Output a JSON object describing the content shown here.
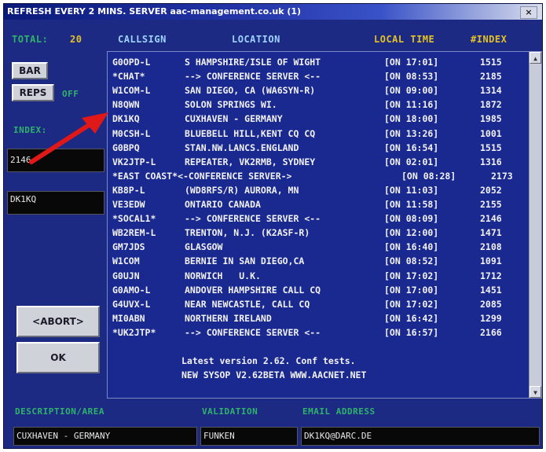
{
  "window": {
    "title": "REFRESH EVERY 2 MINS.  SERVER aac-management.co.uk (1)",
    "ctrl": "×"
  },
  "header": {
    "total_label": "TOTAL:",
    "total_value": "20",
    "callsign": "CALLSIGN",
    "location": "LOCATION",
    "local_time": "LOCAL TIME",
    "index": "#INDEX"
  },
  "sidebar": {
    "bar": "BAR",
    "reps": "REPS",
    "reps_state": "OFF",
    "index_label": "INDEX:",
    "index_value": "2146",
    "callsign_value": "DK1KQ",
    "abort": "<ABORT>",
    "ok": "OK"
  },
  "rows": [
    {
      "call": "G0OPD-L",
      "loc": "S HAMPSHIRE/ISLE OF WIGHT",
      "time": "[ON 17:01]",
      "idx": "1515"
    },
    {
      "call": "*CHAT*",
      "loc": "--> CONFERENCE SERVER <--",
      "time": "[ON 08:53]",
      "idx": "2185"
    },
    {
      "call": "W1COM-L",
      "loc": "SAN DIEGO, CA (WA6SYN-R)",
      "time": "[ON 09:00]",
      "idx": "1314"
    },
    {
      "call": "N8QWN",
      "loc": "SOLON SPRINGS WI.",
      "time": "[ON 11:16]",
      "idx": "1872"
    },
    {
      "call": "DK1KQ",
      "loc": "CUXHAVEN - GERMANY",
      "time": "[ON 18:00]",
      "idx": "1985"
    },
    {
      "call": "M0CSH-L",
      "loc": "BLUEBELL HILL,KENT CQ CQ",
      "time": "[ON 13:26]",
      "idx": "1001"
    },
    {
      "call": "G0BPQ",
      "loc": "STAN.NW.LANCS.ENGLAND",
      "time": "[ON 16:54]",
      "idx": "1515"
    },
    {
      "call": "VK2JTP-L",
      "loc": "REPEATER, VK2RMB, SYDNEY",
      "time": "[ON 02:01]",
      "idx": "1316"
    },
    {
      "call": "*EAST COAST*<-CONFERENCE SERVER->",
      "loc": "",
      "time": "[ON 08:28]",
      "idx": "2173",
      "wide": true
    },
    {
      "call": "KB8P-L",
      "loc": "(WD8RFS/R) AURORA, MN",
      "time": "[ON 11:03]",
      "idx": "2052"
    },
    {
      "call": "VE3EDW",
      "loc": "ONTARIO CANADA",
      "time": "[ON 11:58]",
      "idx": "2155"
    },
    {
      "call": "*SOCAL1*",
      "loc": "--> CONFERENCE SERVER <--",
      "time": "[ON 08:09]",
      "idx": "2146"
    },
    {
      "call": "WB2REM-L",
      "loc": "TRENTON, N.J. (K2ASF-R)",
      "time": "[ON 12:00]",
      "idx": "1471"
    },
    {
      "call": "GM7JDS",
      "loc": "GLASGOW",
      "time": "[ON 16:40]",
      "idx": "2108"
    },
    {
      "call": "W1COM",
      "loc": "BERNIE IN SAN DIEGO,CA",
      "time": "[ON 08:52]",
      "idx": "1091"
    },
    {
      "call": "G0UJN",
      "loc": "NORWICH   U.K.",
      "time": "[ON 17:02]",
      "idx": "1712"
    },
    {
      "call": "G0AMO-L",
      "loc": "ANDOVER HAMPSHIRE CALL CQ",
      "time": "[ON 17:00]",
      "idx": "1451"
    },
    {
      "call": "G4UVX-L",
      "loc": "NEAR NEWCASTLE, CALL CQ",
      "time": "[ON 17:02]",
      "idx": "2085"
    },
    {
      "call": "MI0ABN",
      "loc": "NORTHERN IRELAND",
      "time": "[ON 16:42]",
      "idx": "1299"
    },
    {
      "call": "*UK2JTP*",
      "loc": "--> CONFERENCE SERVER <--",
      "time": "[ON 16:57]",
      "idx": "2166"
    }
  ],
  "footer_lines": {
    "line1": "Latest version 2.62. Conf tests.",
    "line2": "NEW SYSOP V2.62BETA WWW.AACNET.NET"
  },
  "bottom": {
    "desc_label": "DESCRIPTION/AREA",
    "desc_value": "CUXHAVEN - GERMANY",
    "valid_label": "VALIDATION",
    "valid_value": "FUNKEN",
    "email_label": "EMAIL ADDRESS",
    "email_value": "DK1KQ@DARC.DE"
  },
  "icons": {
    "scroll_up": "scroll-up-icon",
    "scroll_down": "scroll-down-icon",
    "arrow": "red-arrow-icon"
  },
  "colors": {
    "background": "#1c2a83",
    "list_bg": "#1a2990",
    "green": "#2fb36a",
    "yellow": "#e3c227",
    "arrow": "#e01818"
  }
}
